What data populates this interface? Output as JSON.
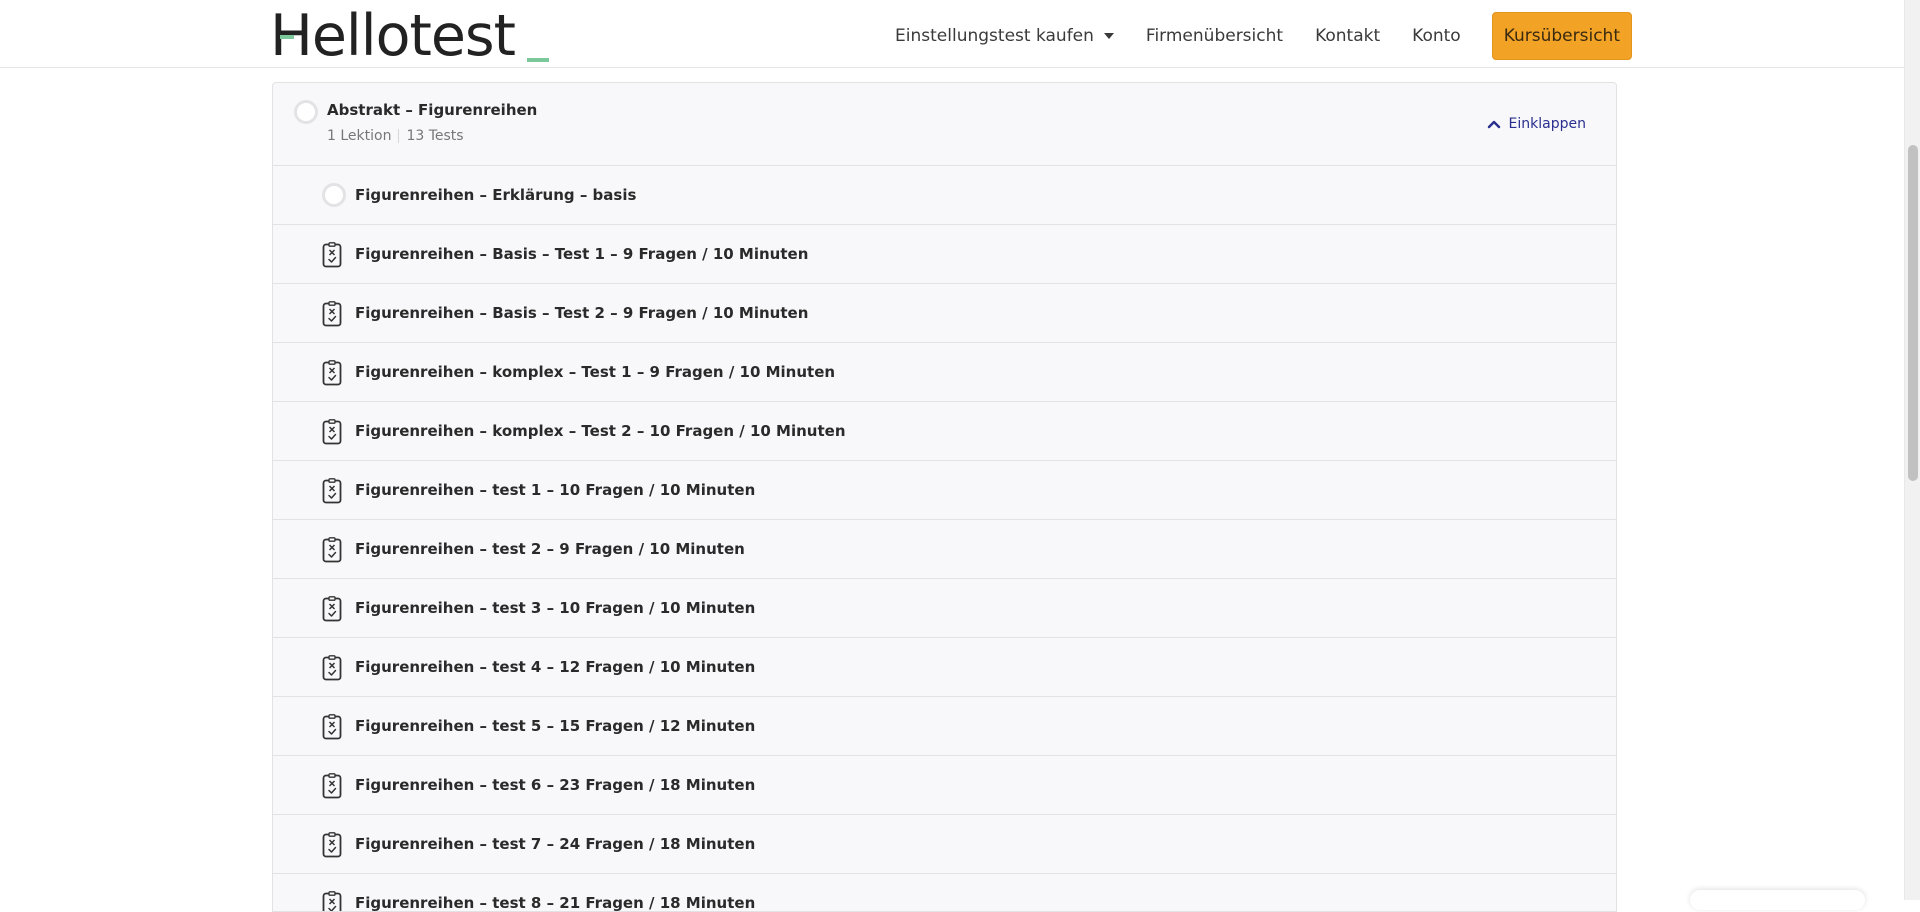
{
  "header": {
    "logo": "Hellotest",
    "nav": [
      {
        "label": "Einstellungstest kaufen",
        "dropdown": true
      },
      {
        "label": "Firmenübersicht"
      },
      {
        "label": "Kontakt"
      },
      {
        "label": "Konto"
      }
    ],
    "cta_label": "Kursübersicht",
    "cta_color": "#f2a225",
    "accent_color": "#7bc99a"
  },
  "section": {
    "title": "Abstrakt – Figurenreihen",
    "lessons": "1 Lektion",
    "tests": "13 Tests",
    "collapse_label": "Einklappen"
  },
  "items": [
    {
      "type": "lesson",
      "icon": "circle-status-icon",
      "label": "Figurenreihen – Erklärung – basis"
    },
    {
      "type": "quiz",
      "icon": "quiz-icon",
      "label": "Figurenreihen – Basis – Test 1 – 9 Fragen / 10 Minuten"
    },
    {
      "type": "quiz",
      "icon": "quiz-icon",
      "label": "Figurenreihen – Basis – Test 2 – 9 Fragen / 10 Minuten"
    },
    {
      "type": "quiz",
      "icon": "quiz-icon",
      "label": "Figurenreihen – komplex – Test 1 – 9 Fragen / 10 Minuten"
    },
    {
      "type": "quiz",
      "icon": "quiz-icon",
      "label": "Figurenreihen – komplex – Test 2 – 10 Fragen / 10 Minuten"
    },
    {
      "type": "quiz",
      "icon": "quiz-icon",
      "label": "Figurenreihen – test 1 – 10 Fragen / 10 Minuten"
    },
    {
      "type": "quiz",
      "icon": "quiz-icon",
      "label": "Figurenreihen – test 2 – 9 Fragen / 10 Minuten"
    },
    {
      "type": "quiz",
      "icon": "quiz-icon",
      "label": "Figurenreihen – test 3 – 10 Fragen / 10 Minuten"
    },
    {
      "type": "quiz",
      "icon": "quiz-icon",
      "label": "Figurenreihen – test 4 – 12 Fragen / 10 Minuten"
    },
    {
      "type": "quiz",
      "icon": "quiz-icon",
      "label": "Figurenreihen – test 5 – 15 Fragen / 12 Minuten"
    },
    {
      "type": "quiz",
      "icon": "quiz-icon",
      "label": "Figurenreihen – test 6 – 23 Fragen / 18 Minuten"
    },
    {
      "type": "quiz",
      "icon": "quiz-icon",
      "label": "Figurenreihen – test 7 – 24 Fragen / 18 Minuten"
    },
    {
      "type": "quiz",
      "icon": "quiz-icon",
      "label": "Figurenreihen – test 8 – 21 Fragen / 18 Minuten"
    }
  ]
}
